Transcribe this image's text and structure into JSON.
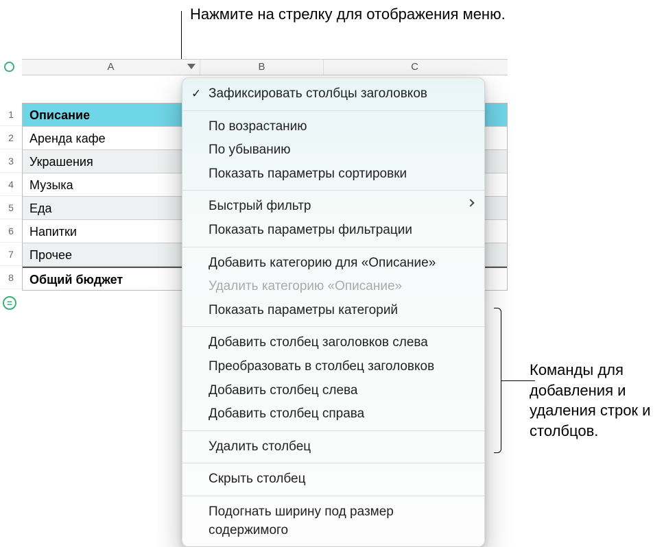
{
  "callouts": {
    "top": "Нажмите на стрелку для отображения меню.",
    "right": "Команды для добавления и удаления строк и столбцов."
  },
  "columns": {
    "a": "A",
    "b": "B",
    "c": "C"
  },
  "row_numbers": [
    "1",
    "2",
    "3",
    "4",
    "5",
    "6",
    "7",
    "8"
  ],
  "rows": [
    {
      "a": "Описание",
      "header": true
    },
    {
      "a": "Аренда кафе"
    },
    {
      "a": "Украшения",
      "alt": true
    },
    {
      "a": "Музыка"
    },
    {
      "a": "Еда",
      "alt": true
    },
    {
      "a": "Напитки"
    },
    {
      "a": "Прочее",
      "alt": true
    },
    {
      "a": "Общий бюджет",
      "total": true
    }
  ],
  "equals_symbol": "=",
  "menu": {
    "items": [
      {
        "label": "Зафиксировать столбцы заголовков",
        "checked": true
      },
      {
        "sep": true
      },
      {
        "label": "По возрастанию"
      },
      {
        "label": "По убыванию"
      },
      {
        "label": "Показать параметры сортировки"
      },
      {
        "sep": true
      },
      {
        "label": "Быстрый фильтр",
        "submenu": true
      },
      {
        "label": "Показать параметры фильтрации"
      },
      {
        "sep": true
      },
      {
        "label": "Добавить категорию для «Описание»"
      },
      {
        "label": "Удалить категорию «Описание»",
        "disabled": true
      },
      {
        "label": "Показать параметры категорий"
      },
      {
        "sep": true
      },
      {
        "label": "Добавить столбец заголовков слева"
      },
      {
        "label": "Преобразовать в столбец заголовков"
      },
      {
        "label": "Добавить столбец слева"
      },
      {
        "label": "Добавить столбец справа"
      },
      {
        "sep": true
      },
      {
        "label": "Удалить столбец"
      },
      {
        "sep": true
      },
      {
        "label": "Скрыть столбец"
      },
      {
        "sep": true
      },
      {
        "label": "Подогнать ширину под размер содержимого"
      }
    ]
  }
}
